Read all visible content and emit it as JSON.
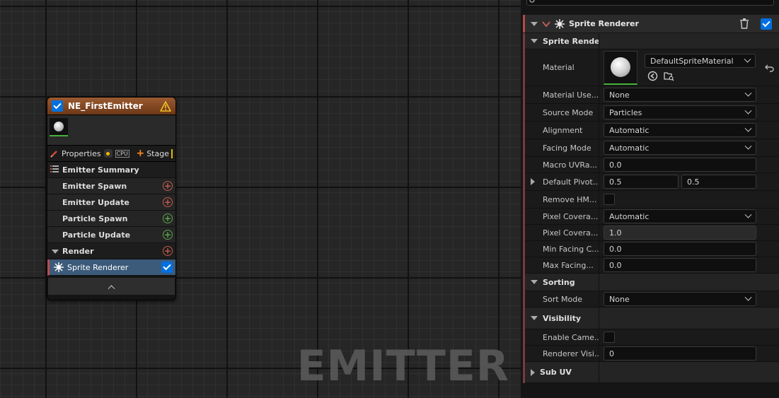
{
  "graph": {
    "watermark": "EMITTER",
    "node": {
      "title": "NE_FirstEmitter",
      "tabs": {
        "properties": "Properties",
        "cpu": "CPU",
        "stage": "Stage"
      },
      "emitter_summary": "Emitter Summary",
      "rows": [
        {
          "label": "Emitter Spawn",
          "add": "red"
        },
        {
          "label": "Emitter Update",
          "add": "red"
        },
        {
          "label": "Particle Spawn",
          "add": "green"
        },
        {
          "label": "Particle Update",
          "add": "green"
        }
      ],
      "render_section": "Render",
      "selected_item": "Sprite Renderer"
    }
  },
  "panel": {
    "category_title": "Sprite Renderer",
    "sections": {
      "sprite_rendering": "Sprite Renderir",
      "sorting": "Sorting",
      "visibility": "Visibility",
      "sub_uv": "Sub UV"
    },
    "material": {
      "label": "Material",
      "value": "DefaultSpriteMaterial"
    },
    "props": {
      "material_user": {
        "label": "Material Use...",
        "value": "None"
      },
      "source_mode": {
        "label": "Source Mode",
        "value": "Particles"
      },
      "alignment": {
        "label": "Alignment",
        "value": "Automatic"
      },
      "facing_mode": {
        "label": "Facing Mode",
        "value": "Automatic"
      },
      "macro_uv": {
        "label": "Macro UVRa...",
        "value": "0.0"
      },
      "pivot": {
        "label": "Default Pivot...",
        "x": "0.5",
        "y": "0.5"
      },
      "remove_hmd": {
        "label": "Remove HM..."
      },
      "pixel_cov_mode": {
        "label": "Pixel Covera...",
        "value": "Automatic"
      },
      "pixel_cov_val": {
        "label": "Pixel Covera...",
        "value": "1.0"
      },
      "min_facing": {
        "label": "Min Facing C...",
        "value": "0.0"
      },
      "max_facing": {
        "label": "Max Facing...",
        "value": "0.0"
      },
      "sort_mode": {
        "label": "Sort Mode",
        "value": "None"
      },
      "enable_camera": {
        "label": "Enable Came..."
      },
      "renderer_vis": {
        "label": "Renderer Visi...",
        "value": "0"
      }
    }
  }
}
